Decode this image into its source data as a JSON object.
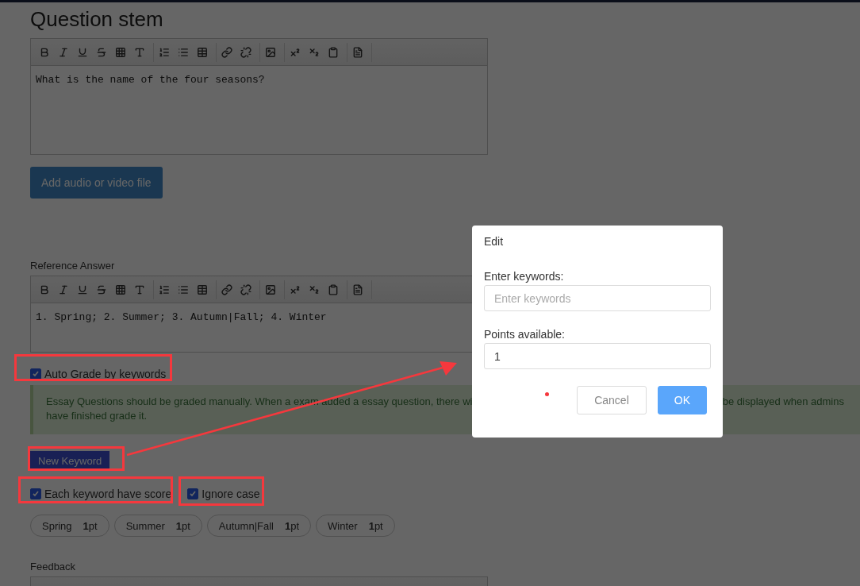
{
  "title": "Question stem",
  "stem_editor": {
    "content": "What is the name of the four seasons?"
  },
  "media_button": "Add audio or video file",
  "reference_answer": {
    "label": "Reference Answer",
    "content": "1. Spring; 2. Summer; 3. Autumn|Fall; 4. Winter"
  },
  "auto_grade": {
    "label": "Auto Grade by keywords",
    "checked": true
  },
  "notice": {
    "line_1_start": "Essay Questions should be graded manually. When a exam added a essay question, there wi",
    "line_1_end": "be displayed when admins",
    "line_2": "have finished grade it."
  },
  "new_keyword_button": "New Keyword",
  "options": [
    {
      "label": "Each keyword have score",
      "checked": true
    },
    {
      "label": "Ignore case",
      "checked": true
    }
  ],
  "keywords": [
    {
      "word": "Spring",
      "points": "1",
      "unit": "pt"
    },
    {
      "word": "Summer",
      "points": "1",
      "unit": "pt"
    },
    {
      "word": "Autumn|Fall",
      "points": "1",
      "unit": "pt"
    },
    {
      "word": "Winter",
      "points": "1",
      "unit": "pt"
    }
  ],
  "feedback": {
    "label": "Feedback"
  },
  "dialog": {
    "title": "Edit",
    "fields": [
      {
        "label": "Enter keywords:",
        "placeholder": "Enter keywords"
      },
      {
        "label": "Points available:",
        "value": "1"
      }
    ],
    "buttons": [
      {
        "label": "Cancel",
        "kind": "secondary"
      },
      {
        "label": "OK",
        "kind": "primary"
      }
    ]
  }
}
